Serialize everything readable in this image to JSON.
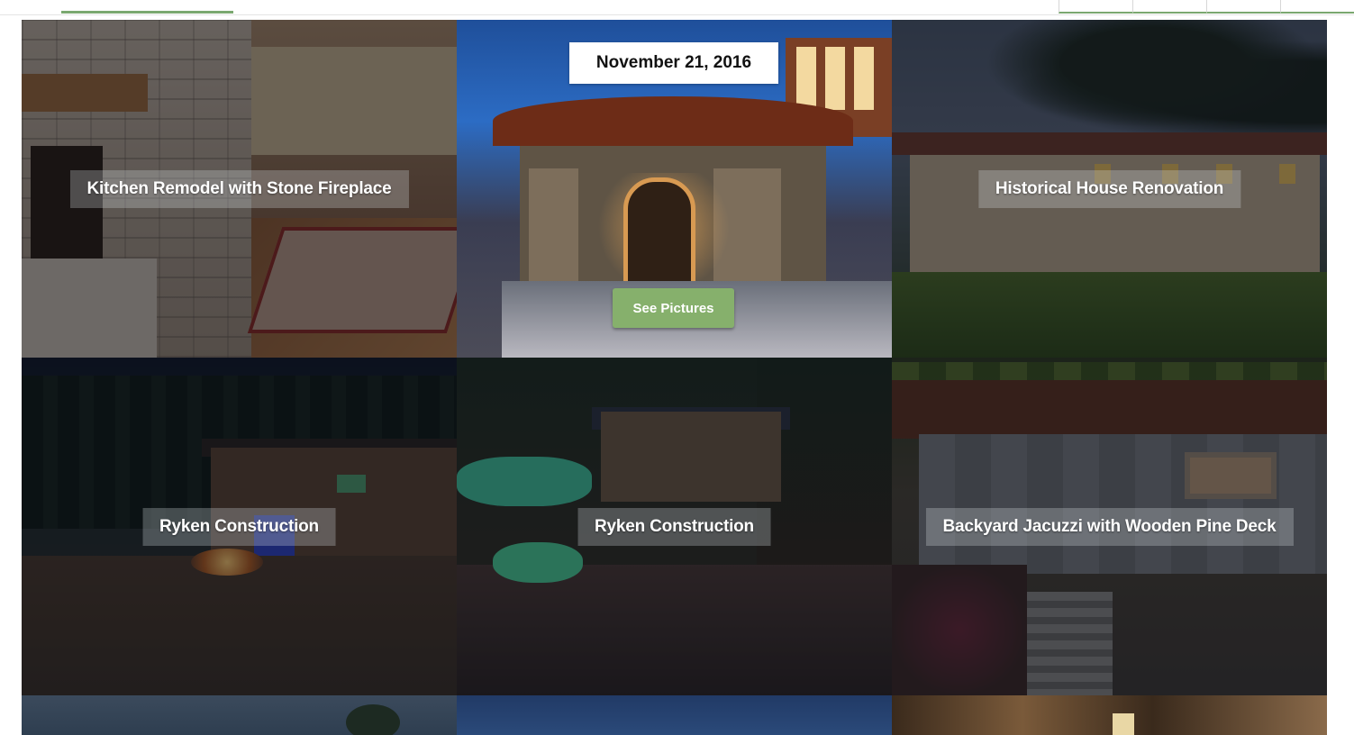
{
  "gallery": {
    "hover": {
      "date": "November 21, 2016",
      "button_label": "See Pictures"
    },
    "tiles": [
      {
        "title": "Kitchen Remodel with Stone Fireplace"
      },
      {
        "title": ""
      },
      {
        "title": "Historical House Renovation"
      },
      {
        "title": "Ryken Construction"
      },
      {
        "title": "Ryken Construction"
      },
      {
        "title": "Backyard Jacuzzi with Wooden Pine Deck"
      }
    ]
  },
  "colors": {
    "accent_green": "#86b06c",
    "tab_underline": "#7aa870"
  }
}
